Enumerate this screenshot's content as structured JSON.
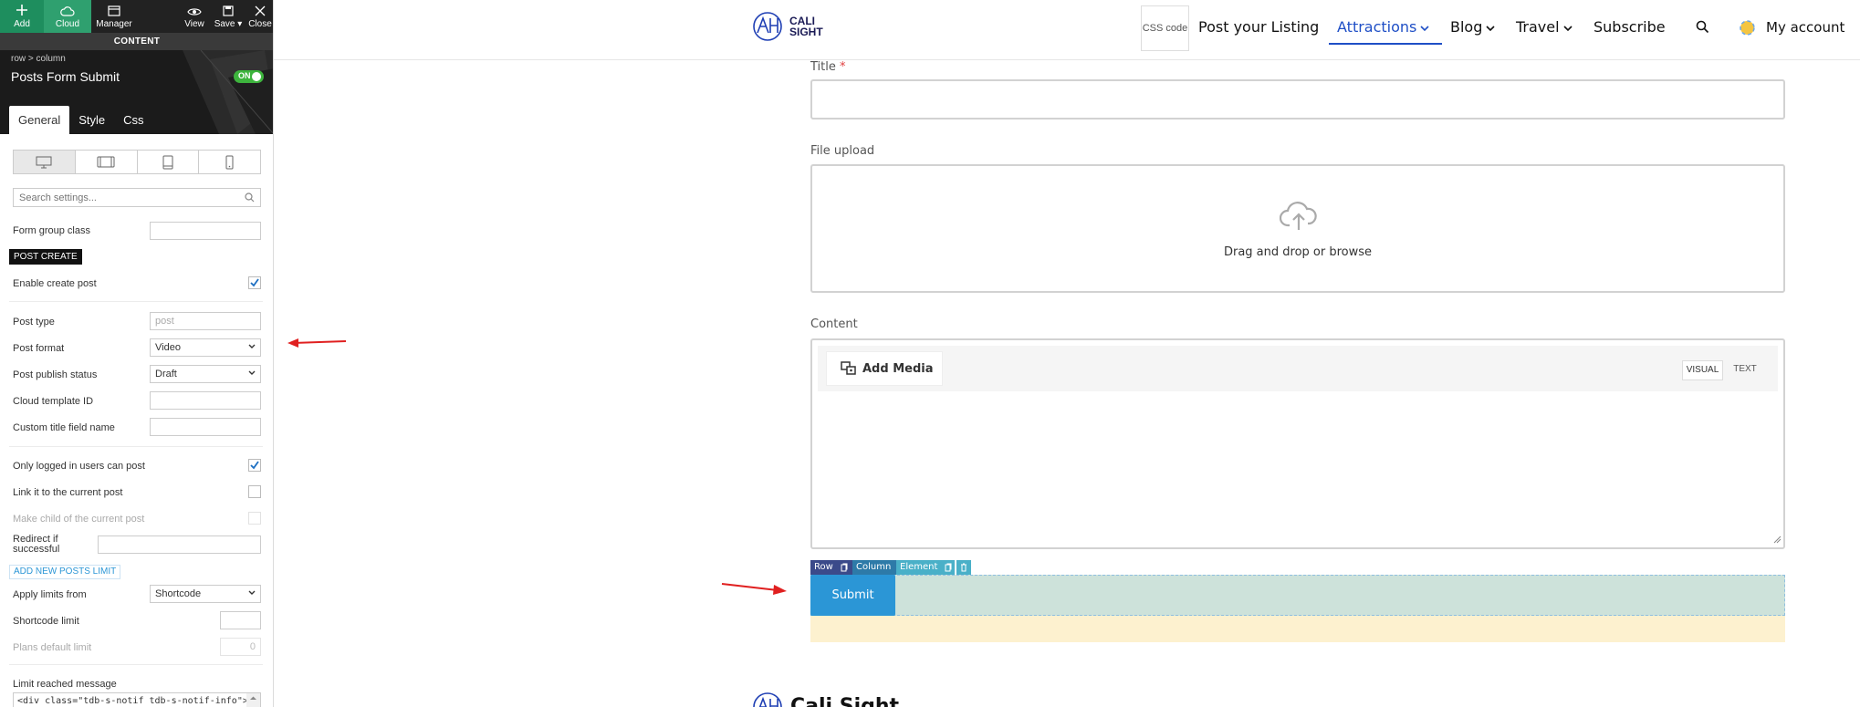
{
  "builder": {
    "toolbar": {
      "add": "Add",
      "cloud": "Cloud",
      "manager": "Manager",
      "view": "View",
      "save": "Save",
      "close": "Close"
    },
    "content_label": "CONTENT",
    "breadcrumb": {
      "row": "row",
      "sep": ">",
      "column": "column"
    },
    "element_title": "Posts Form Submit",
    "toggle": "ON",
    "tabs": [
      "General",
      "Style",
      "Css"
    ],
    "search_placeholder": "Search settings...",
    "form_group_class": "Form group class",
    "section_post_create": "POST CREATE",
    "enable_create_post": "Enable create post",
    "post_type": {
      "label": "Post type",
      "value": "post"
    },
    "post_format": {
      "label": "Post format",
      "value": "Video"
    },
    "post_publish_status": {
      "label": "Post publish status",
      "value": "Draft"
    },
    "cloud_template_id": "Cloud template ID",
    "custom_title_field": "Custom title field name",
    "only_logged_in": "Only logged in users can post",
    "link_current": "Link it to the current post",
    "make_child": "Make child of the current post",
    "redirect_line1": "Redirect if",
    "redirect_line2": "successful",
    "add_limit": "ADD NEW POSTS LIMIT",
    "apply_limits": {
      "label": "Apply limits from",
      "value": "Shortcode"
    },
    "shortcode_limit": "Shortcode limit",
    "plans_default": {
      "label": "Plans default limit",
      "value": "0"
    },
    "limit_message": "Limit reached message",
    "limit_code": "<div class=\"tdb-s-notif tdb-s-notif-info\">"
  },
  "site": {
    "logo_line1": "CALI",
    "logo_line2": "SIGHT",
    "css_code": "CSS code",
    "nav": [
      "Post your Listing",
      "Attractions",
      "Blog",
      "Travel",
      "Subscribe"
    ],
    "my_account": "My account",
    "title_label": "Title",
    "required": "*",
    "file_upload_label": "File upload",
    "drag_drop": "Drag and drop or browse",
    "content_label": "Content",
    "add_media": "Add Media",
    "visual": "VISUAL",
    "text": "TEXT",
    "vc": [
      "Row",
      "Column",
      "Element"
    ],
    "submit": "Submit",
    "footer_brand": "Cali Sight"
  },
  "colors": {
    "accent": "#1f4fc6",
    "submit": "#2b96d6",
    "toggle": "#3db43d",
    "annotation": "#e02020"
  }
}
